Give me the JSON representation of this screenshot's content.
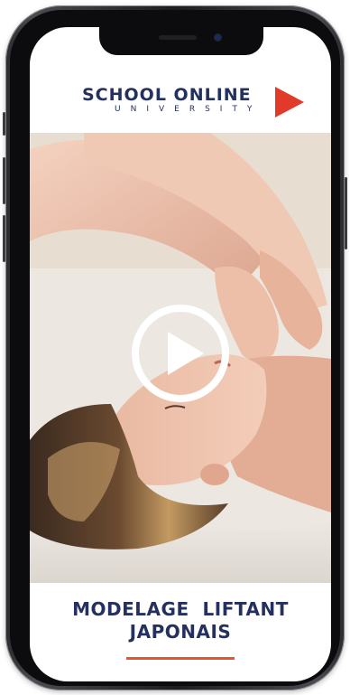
{
  "header": {
    "logo_word": "SCHOOL ONLINE",
    "logo_subword": "UNIVERSITY",
    "logo_arrow_icon": "play-triangle-icon",
    "brand_color": "#24305e",
    "accent_color": "#e23a2a"
  },
  "video": {
    "play_icon": "play-icon"
  },
  "course": {
    "title_line_1": "MODELAGE  LIFTANT",
    "title_line_2": "JAPONAIS",
    "underline_color": "#e8542c"
  }
}
